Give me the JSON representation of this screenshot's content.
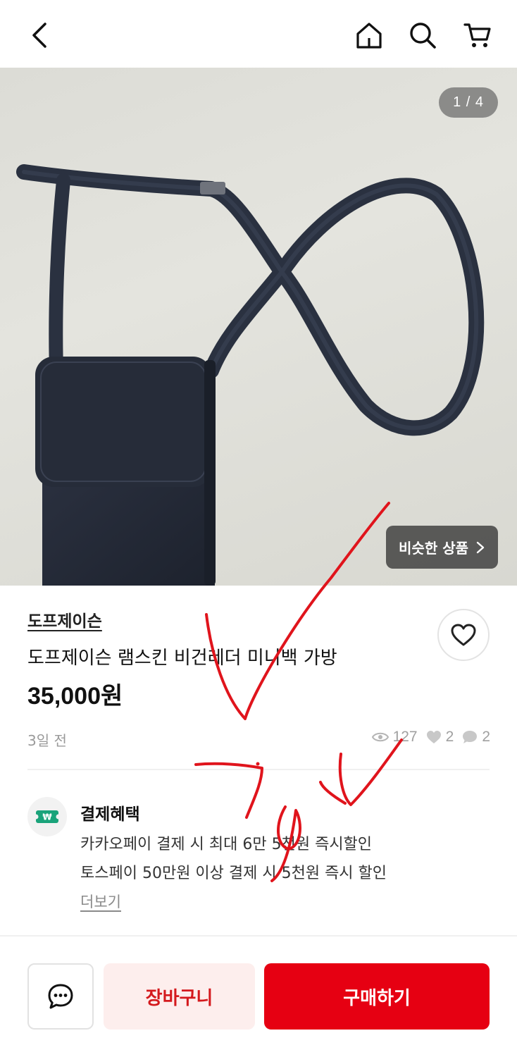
{
  "header": {
    "back_icon": "chevron-left-icon",
    "home_icon": "home-icon",
    "search_icon": "search-icon",
    "cart_icon": "cart-icon"
  },
  "gallery": {
    "counter": "1 / 4",
    "similar_label": "비슷한 상품"
  },
  "product": {
    "seller": "도프제이슨",
    "title": "도프제이슨 램스킨 비건레더 미니백 가방",
    "price": "35,000원",
    "posted": "3일 전",
    "views": "127",
    "likes": "2",
    "chats": "2"
  },
  "benefit": {
    "title": "결제혜택",
    "line1": "카카오페이 결제 시 최대 6만 5천원 즉시할인",
    "line2": "토스페이 50만원 이상 결제 시 5천원 즉시 할인",
    "more": "더보기"
  },
  "actions": {
    "cart_label": "장바구니",
    "buy_label": "구매하기"
  },
  "colors": {
    "accent": "#e60012",
    "cart_bg": "#fdeeed",
    "cart_text": "#d4191d"
  }
}
